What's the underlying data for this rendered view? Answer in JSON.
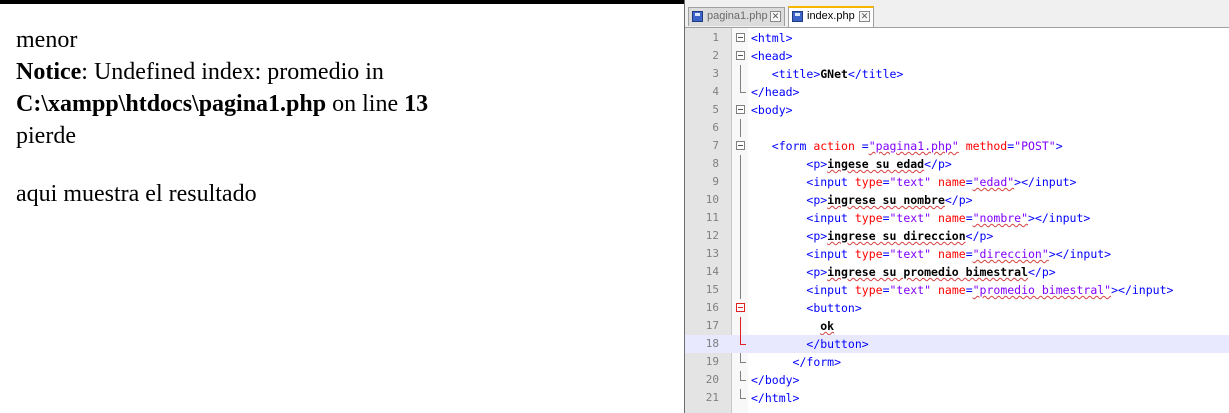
{
  "browser": {
    "line1": "menor",
    "notice_label": "Notice",
    "notice_text": ": Undefined index: promedio in ",
    "notice_path": "C:\\xampp\\htdocs\\pagina1.php",
    "notice_online": " on line ",
    "notice_linenum": "13",
    "line3": "pierde",
    "line4": "aqui muestra el resultado"
  },
  "editor": {
    "tabs": [
      {
        "label": "pagina1.php",
        "active": false
      },
      {
        "label": "index.php",
        "active": true
      }
    ],
    "current_line": 18,
    "lines": [
      {
        "n": "1",
        "t": [
          [
            "tg",
            "<html>"
          ]
        ]
      },
      {
        "n": "2",
        "t": [
          [
            "tg",
            "<head>"
          ]
        ]
      },
      {
        "n": "3",
        "t": [
          [
            "sp",
            "   "
          ],
          [
            "tg",
            "<title>"
          ],
          [
            "tx",
            "GNet"
          ],
          [
            "tg",
            "</title>"
          ]
        ]
      },
      {
        "n": "4",
        "t": [
          [
            "tg",
            "</head>"
          ]
        ]
      },
      {
        "n": "5",
        "t": [
          [
            "tg",
            "<body>"
          ]
        ]
      },
      {
        "n": "6",
        "t": []
      },
      {
        "n": "7",
        "t": [
          [
            "sp",
            "   "
          ],
          [
            "tg",
            "<form "
          ],
          [
            "at",
            "action "
          ],
          [
            "tg",
            "="
          ],
          [
            "st",
            "\"pagina1.php\""
          ],
          [
            "tg",
            " "
          ],
          [
            "at",
            "method"
          ],
          [
            "tg",
            "="
          ],
          [
            "st",
            "\"POST\""
          ],
          [
            "tg",
            ">"
          ]
        ]
      },
      {
        "n": "8",
        "t": [
          [
            "sp",
            "        "
          ],
          [
            "tg",
            "<p>"
          ],
          [
            "tx",
            "ingese su edad"
          ],
          [
            "tg",
            "</p>"
          ]
        ]
      },
      {
        "n": "9",
        "t": [
          [
            "sp",
            "        "
          ],
          [
            "tg",
            "<input "
          ],
          [
            "at",
            "type"
          ],
          [
            "tg",
            "="
          ],
          [
            "st",
            "\"text\""
          ],
          [
            "tg",
            " "
          ],
          [
            "at",
            "name"
          ],
          [
            "tg",
            "="
          ],
          [
            "st",
            "\"edad\""
          ],
          [
            "tg",
            "></input>"
          ]
        ]
      },
      {
        "n": "10",
        "t": [
          [
            "sp",
            "        "
          ],
          [
            "tg",
            "<p>"
          ],
          [
            "tx",
            "ingrese su nombre"
          ],
          [
            "tg",
            "</p>"
          ]
        ]
      },
      {
        "n": "11",
        "t": [
          [
            "sp",
            "        "
          ],
          [
            "tg",
            "<input "
          ],
          [
            "at",
            "type"
          ],
          [
            "tg",
            "="
          ],
          [
            "st",
            "\"text\""
          ],
          [
            "tg",
            " "
          ],
          [
            "at",
            "name"
          ],
          [
            "tg",
            "="
          ],
          [
            "st",
            "\"nombre\""
          ],
          [
            "tg",
            "></input>"
          ]
        ]
      },
      {
        "n": "12",
        "t": [
          [
            "sp",
            "        "
          ],
          [
            "tg",
            "<p>"
          ],
          [
            "tx",
            "ingrese su direccion"
          ],
          [
            "tg",
            "</p>"
          ]
        ]
      },
      {
        "n": "13",
        "t": [
          [
            "sp",
            "        "
          ],
          [
            "tg",
            "<input "
          ],
          [
            "at",
            "type"
          ],
          [
            "tg",
            "="
          ],
          [
            "st",
            "\"text\""
          ],
          [
            "tg",
            " "
          ],
          [
            "at",
            "name"
          ],
          [
            "tg",
            "="
          ],
          [
            "st",
            "\"direccion\""
          ],
          [
            "tg",
            "></input>"
          ]
        ]
      },
      {
        "n": "14",
        "t": [
          [
            "sp",
            "        "
          ],
          [
            "tg",
            "<p>"
          ],
          [
            "tx",
            "ingrese su promedio bimestral"
          ],
          [
            "tg",
            "</p>"
          ]
        ]
      },
      {
        "n": "15",
        "t": [
          [
            "sp",
            "        "
          ],
          [
            "tg",
            "<input "
          ],
          [
            "at",
            "type"
          ],
          [
            "tg",
            "="
          ],
          [
            "st",
            "\"text\""
          ],
          [
            "tg",
            " "
          ],
          [
            "at",
            "name"
          ],
          [
            "tg",
            "="
          ],
          [
            "st",
            "\"promedio bimestral\""
          ],
          [
            "tg",
            "></input>"
          ]
        ]
      },
      {
        "n": "16",
        "t": [
          [
            "sp",
            "        "
          ],
          [
            "tg",
            "<button>"
          ]
        ]
      },
      {
        "n": "17",
        "t": [
          [
            "sp",
            "          "
          ],
          [
            "tx",
            "ok"
          ]
        ]
      },
      {
        "n": "18",
        "t": [
          [
            "sp",
            "        "
          ],
          [
            "tg",
            "</button>"
          ]
        ]
      },
      {
        "n": "19",
        "t": [
          [
            "sp",
            "      "
          ],
          [
            "tg",
            "</form>"
          ]
        ]
      },
      {
        "n": "20",
        "t": [
          [
            "tg",
            "</body>"
          ]
        ]
      },
      {
        "n": "21",
        "t": [
          [
            "tg",
            "</html>"
          ]
        ]
      }
    ]
  }
}
